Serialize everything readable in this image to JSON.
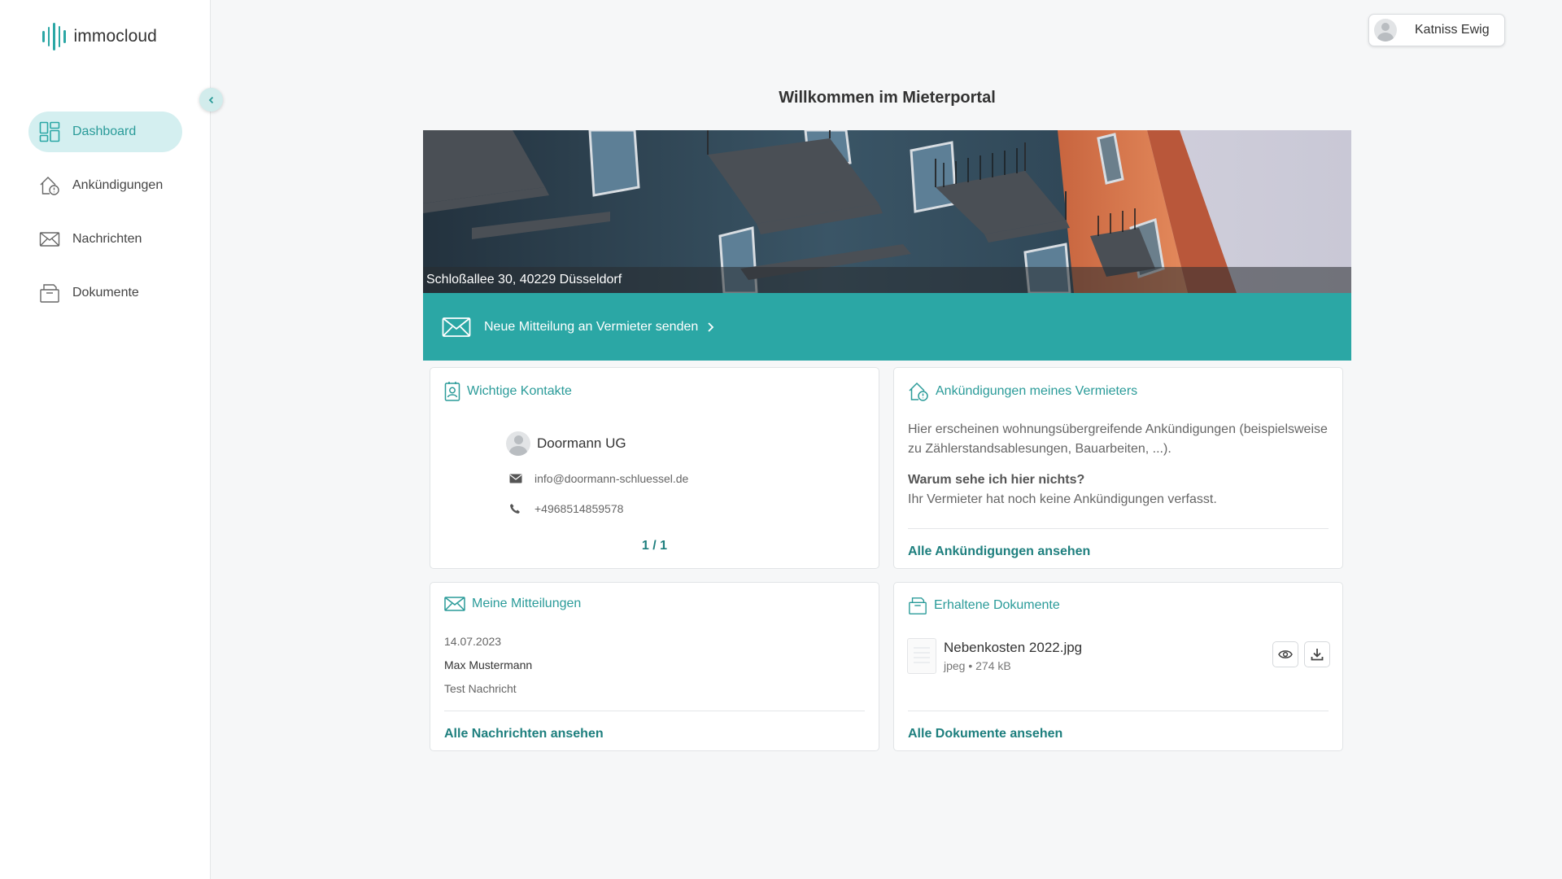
{
  "app": {
    "name": "immocloud"
  },
  "sidebar": {
    "items": [
      {
        "label": "Dashboard",
        "icon": "dashboard-icon",
        "active": true
      },
      {
        "label": "Ankündigungen",
        "icon": "house-announcement-icon"
      },
      {
        "label": "Nachrichten",
        "icon": "envelope-icon"
      },
      {
        "label": "Dokumente",
        "icon": "document-box-icon"
      }
    ]
  },
  "user": {
    "name": "Katniss Ewig"
  },
  "page": {
    "title": "Willkommen im Mieterportal"
  },
  "hero": {
    "address": "Schloßallee 30, 40229 Düsseldorf"
  },
  "banner": {
    "label": "Neue Mitteilung an Vermieter senden"
  },
  "contacts": {
    "title": "Wichtige Kontakte",
    "name": "Doormann UG",
    "email": "info@doormann-schluessel.de",
    "phone": "+4968514859578",
    "pager": "1 / 1"
  },
  "announcements": {
    "title": "Ankündigungen meines Vermieters",
    "text": "Hier erscheinen wohnungsübergreifende Ankündigungen (beispielsweise zu Zählerstandsablesungen, Bauarbeiten, ...).",
    "question": "Warum sehe ich hier nichts?",
    "answer": "Ihr Vermieter hat noch keine Ankündigungen verfasst.",
    "link": "Alle Ankündigungen ansehen"
  },
  "messages": {
    "title": "Meine Mitteilungen",
    "date": "14.07.2023",
    "sender": "Max Mustermann",
    "subject": "Test Nachricht",
    "link": "Alle Nachrichten ansehen"
  },
  "documents": {
    "title": "Erhaltene Dokumente",
    "file_name": "Nebenkosten 2022.jpg",
    "file_info": "jpeg • 274 kB",
    "link": "Alle Dokumente ansehen"
  },
  "colors": {
    "accent": "#2ba7a5",
    "accent_dark": "#1e7f7e",
    "active_bg": "#d4eff0"
  }
}
